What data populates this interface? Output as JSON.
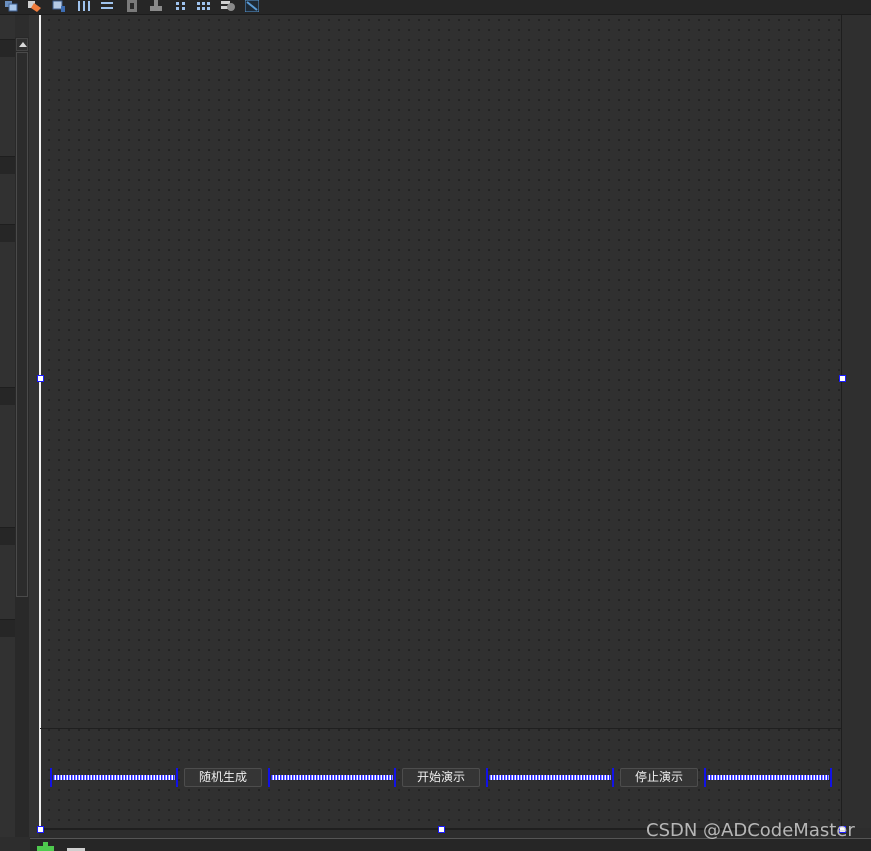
{
  "toolbar": {
    "icons": [
      {
        "name": "edit-widgets-icon"
      },
      {
        "name": "edit-signals-slots-icon"
      },
      {
        "name": "edit-buddies-icon"
      },
      {
        "name": "edit-tab-order-icon"
      },
      {
        "name": "layout-horizontal-icon"
      },
      {
        "name": "layout-vertical-icon"
      },
      {
        "name": "layout-horizontal-splitter-icon"
      },
      {
        "name": "layout-vertical-splitter-icon"
      },
      {
        "name": "layout-form-icon"
      },
      {
        "name": "layout-grid-icon"
      },
      {
        "name": "break-layout-icon"
      },
      {
        "name": "adjust-size-icon"
      }
    ]
  },
  "form": {
    "buttons": {
      "random_generate": "随机生成",
      "start_demo": "开始演示",
      "stop_demo": "停止演示"
    }
  },
  "colors": {
    "selection_handle": "#1a1aff",
    "spacer": "#2020ff",
    "background": "#303030"
  },
  "watermark": "CSDN @ADCodeMaster"
}
